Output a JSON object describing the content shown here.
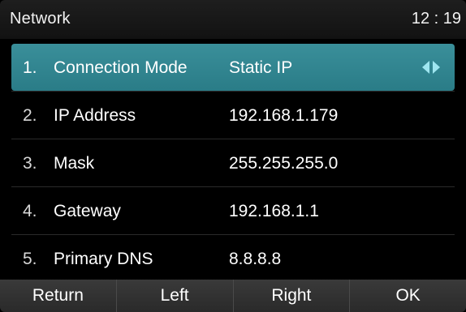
{
  "header": {
    "title": "Network",
    "clock": "12 : 19"
  },
  "rows": [
    {
      "num": "1.",
      "label": "Connection Mode",
      "value": "Static IP"
    },
    {
      "num": "2.",
      "label": "IP Address",
      "value": "192.168.1.179"
    },
    {
      "num": "3.",
      "label": "Mask",
      "value": "255.255.255.0"
    },
    {
      "num": "4.",
      "label": "Gateway",
      "value": "192.168.1.1"
    },
    {
      "num": "5.",
      "label": "Primary DNS",
      "value": "8.8.8.8"
    }
  ],
  "softkeys": {
    "return": "Return",
    "left": "Left",
    "right": "Right",
    "ok": "OK"
  },
  "icons": {
    "selector_left": "triangle-left-icon",
    "selector_right": "triangle-right-icon"
  },
  "colors": {
    "selected_row": "#2f8591",
    "arrow": "#9fe6f0",
    "background": "#000000"
  }
}
